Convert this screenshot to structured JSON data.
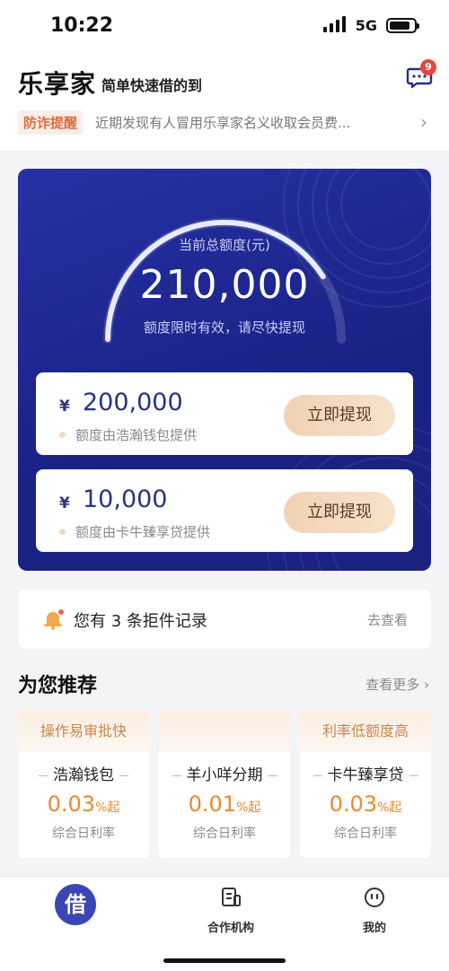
{
  "status_bar": {
    "time": "10:22",
    "network": "5G",
    "battery_level": 0.85
  },
  "header": {
    "brand": "乐享家",
    "slogan": "简单快速借的到",
    "message_badge": "9",
    "icon": "message-icon"
  },
  "notice": {
    "tag": "防诈提醒",
    "text": "近期发现有人冒用乐享家名义收取会员费...",
    "icon": "chevron-right-icon"
  },
  "credit": {
    "label": "当前总额度(元)",
    "amount": "210,000",
    "tip": "额度限时有效，请尽快提现",
    "gauge_fill": 0.82
  },
  "offers": [
    {
      "currency": "¥",
      "amount": "200,000",
      "source": "额度由浩瀚钱包提供",
      "button": "立即提现"
    },
    {
      "currency": "¥",
      "amount": "10,000",
      "source": "额度由卡牛臻享贷提供",
      "button": "立即提现"
    }
  ],
  "reject": {
    "text": "您有 3 条拒件记录",
    "link": "去查看",
    "icon": "bell-icon"
  },
  "recommend": {
    "title": "为您推荐",
    "more": "查看更多",
    "items": [
      {
        "tag": "操作易审批快",
        "name": "浩瀚钱包",
        "rate": "0.03",
        "rate_suffix": "%起",
        "rate_label": "综合日利率"
      },
      {
        "tag": "",
        "name": "羊小咩分期",
        "rate": "0.01",
        "rate_suffix": "%起",
        "rate_label": "综合日利率"
      },
      {
        "tag": "利率低额度高",
        "name": "卡牛臻享贷",
        "rate": "0.03",
        "rate_suffix": "%起",
        "rate_label": "综合日利率"
      }
    ]
  },
  "tabbar": {
    "items": [
      {
        "label": "借",
        "icon": "borrow-icon",
        "active": true
      },
      {
        "label": "合作机构",
        "icon": "document-icon"
      },
      {
        "label": "我的",
        "icon": "profile-icon"
      }
    ]
  },
  "colors": {
    "card": "#1f2790",
    "accent_button": "#f0d2b4",
    "rate": "#ea8a2e",
    "tag": "#e06a3c"
  }
}
